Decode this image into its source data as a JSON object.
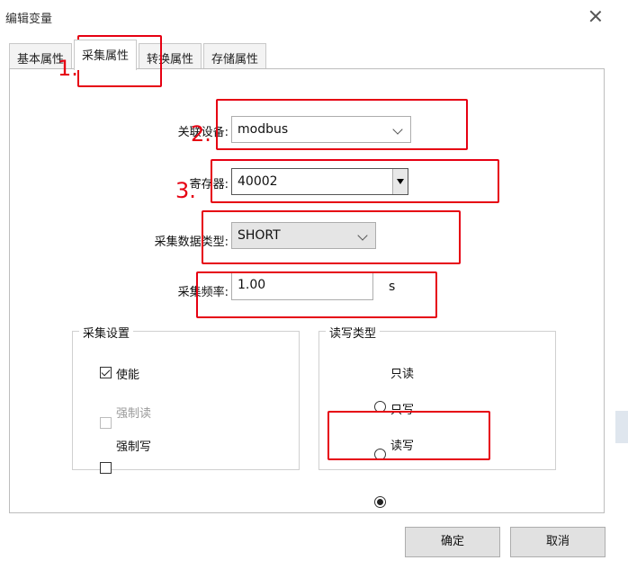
{
  "window": {
    "title": "编辑变量"
  },
  "tabs": [
    {
      "label": "基本属性",
      "active": false
    },
    {
      "label": "采集属性",
      "active": true
    },
    {
      "label": "转换属性",
      "active": false
    },
    {
      "label": "存储属性",
      "active": false
    }
  ],
  "fields": {
    "device": {
      "label": "关联设备:",
      "value": "modbus"
    },
    "register": {
      "label": "寄存器:",
      "value": "40002"
    },
    "datatype": {
      "label": "采集数据类型:",
      "value": "SHORT"
    },
    "freq": {
      "label": "采集频率:",
      "value": "1.00",
      "unit": "s"
    }
  },
  "collect_settings": {
    "title": "采集设置",
    "items": [
      {
        "label": "使能",
        "checked": true,
        "disabled": false
      },
      {
        "label": "强制读",
        "checked": false,
        "disabled": true
      },
      {
        "label": "强制写",
        "checked": false,
        "disabled": false
      }
    ]
  },
  "rw_type": {
    "title": "读写类型",
    "options": [
      {
        "label": "只读",
        "selected": false
      },
      {
        "label": "只写",
        "selected": false
      },
      {
        "label": "读写",
        "selected": true
      }
    ]
  },
  "buttons": {
    "ok": "确定",
    "cancel": "取消"
  },
  "annotations": {
    "step1": "1.",
    "step2": "2.",
    "step3": "3."
  },
  "colors": {
    "annotation_red": "#e60012",
    "button_bg": "#e1e1e1"
  }
}
